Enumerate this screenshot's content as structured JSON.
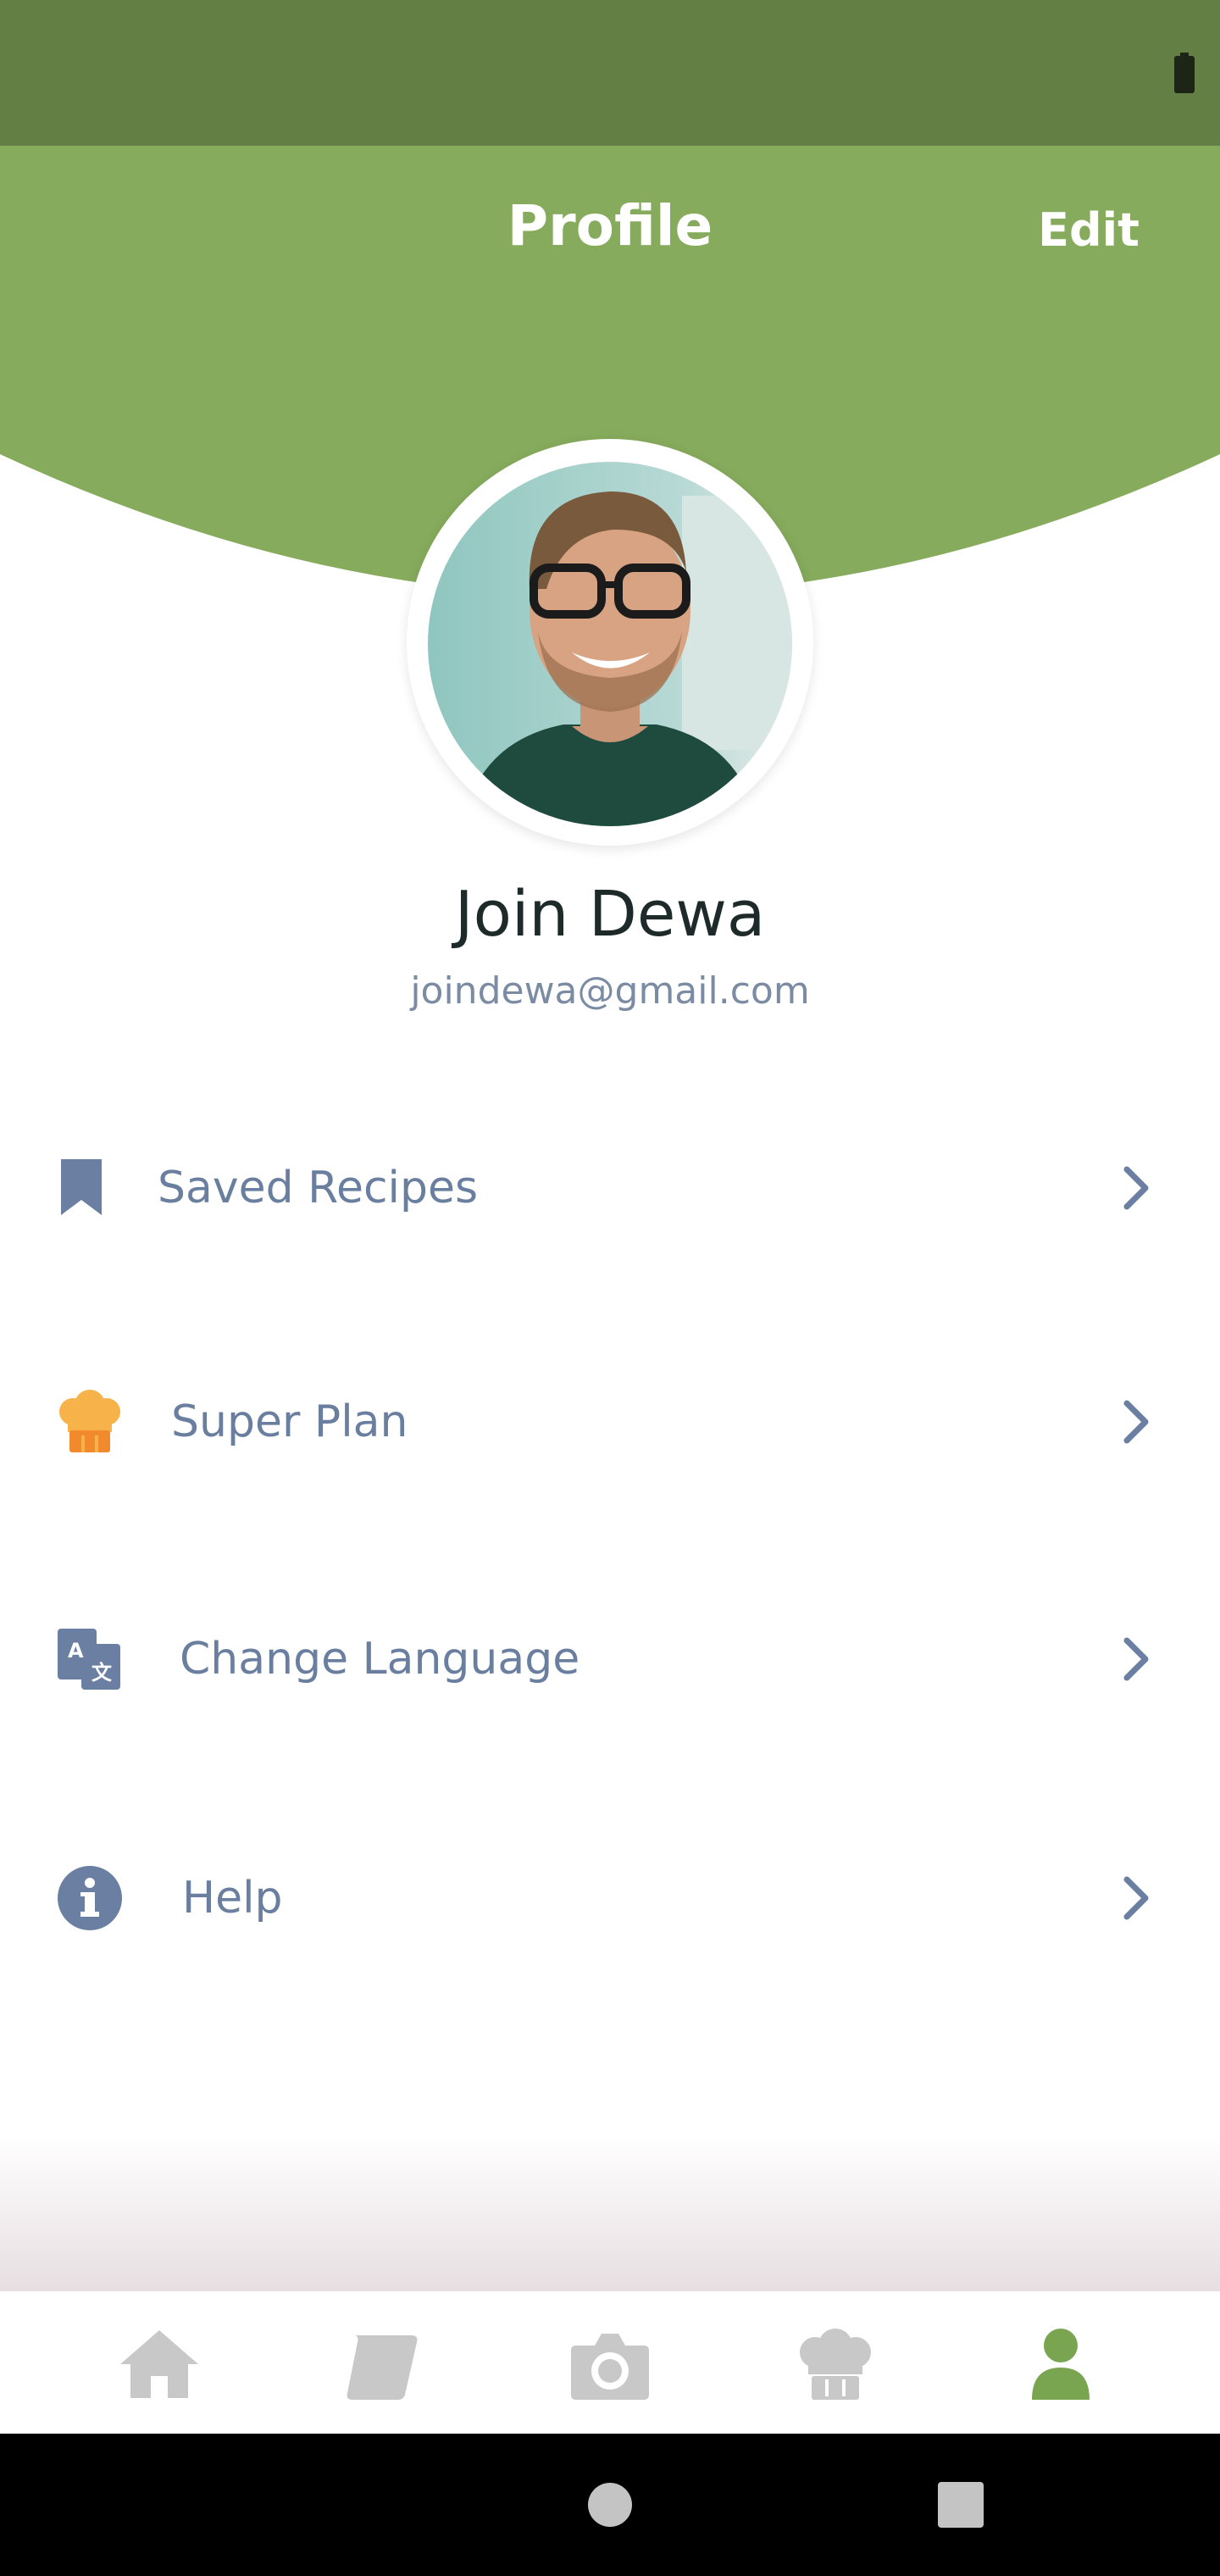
{
  "colors": {
    "status_bar": "#637f43",
    "header": "#86ab5c",
    "active_nav": "#7aa550",
    "inactive_nav": "#c8c8c8",
    "menu_icon": "#6b7fa3",
    "super_plan_icon": "#f5a434"
  },
  "header": {
    "title": "Profile",
    "edit_label": "Edit"
  },
  "profile": {
    "name": "Join Dewa",
    "email": "joindewa@gmail.com",
    "avatar_icon": "user-photo"
  },
  "menu": [
    {
      "icon": "bookmark-icon",
      "label": "Saved Recipes"
    },
    {
      "icon": "chef-hat-icon",
      "label": "Super Plan"
    },
    {
      "icon": "translate-icon",
      "label": "Change Language"
    },
    {
      "icon": "info-icon",
      "label": "Help"
    }
  ],
  "bottom_nav": [
    {
      "icon": "home-icon",
      "active": false
    },
    {
      "icon": "recipe-page-icon",
      "active": false
    },
    {
      "icon": "camera-icon",
      "active": false
    },
    {
      "icon": "chef-hat-icon",
      "active": false
    },
    {
      "icon": "user-icon",
      "active": true
    }
  ]
}
